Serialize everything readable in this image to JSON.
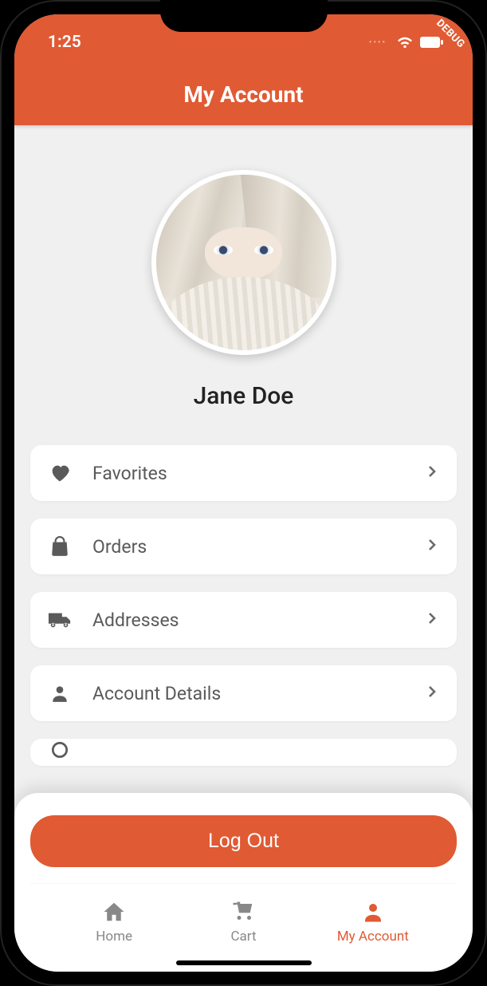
{
  "status": {
    "time": "1:25",
    "debug": "DEBUG"
  },
  "header": {
    "title": "My Account"
  },
  "profile": {
    "name": "Jane Doe"
  },
  "menu": {
    "items": [
      {
        "icon": "heart-icon",
        "label": "Favorites"
      },
      {
        "icon": "bag-icon",
        "label": "Orders"
      },
      {
        "icon": "truck-icon",
        "label": "Addresses"
      },
      {
        "icon": "person-icon",
        "label": "Account Details"
      }
    ]
  },
  "logout": {
    "label": "Log Out"
  },
  "tabs": {
    "items": [
      {
        "icon": "home-icon",
        "label": "Home",
        "active": false
      },
      {
        "icon": "cart-icon",
        "label": "Cart",
        "active": false
      },
      {
        "icon": "account-icon",
        "label": "My Account",
        "active": true
      }
    ]
  },
  "colors": {
    "accent": "#e05a33",
    "muted": "#888",
    "text": "#5a5a5a"
  }
}
